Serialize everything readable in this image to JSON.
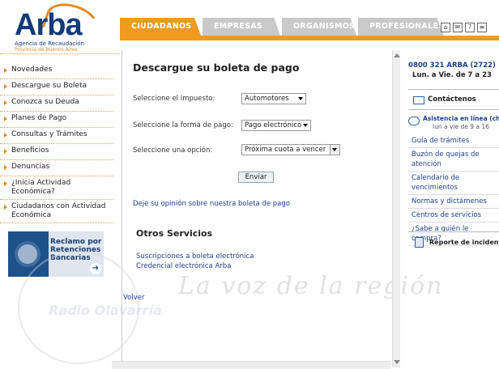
{
  "header": {
    "logo_name": "Arba",
    "logo_subtitle": "Agencia de Recaudación",
    "logo_province": "Provincia de Buenos Aires",
    "tabs": [
      {
        "label": "CIUDADANOS",
        "active": true
      },
      {
        "label": "EMPRESAS",
        "active": false
      },
      {
        "label": "ORGANISMOS",
        "active": false
      },
      {
        "label": "PROFESIONALES",
        "active": false
      }
    ],
    "tool_icons": [
      "home-icon",
      "contact-icon",
      "help-icon",
      "sitemap-icon"
    ],
    "accent_color": "#f19a1f"
  },
  "leftnav": {
    "items": [
      {
        "label": "Novedades"
      },
      {
        "label": "Descargue su Boleta"
      },
      {
        "label": "Conozca su Deuda"
      },
      {
        "label": "Planes de Pago"
      },
      {
        "label": "Consultas y Trámites"
      },
      {
        "label": "Beneficios"
      },
      {
        "label": "Denuncias"
      },
      {
        "label": "¿Inicia Actividad Económica?"
      },
      {
        "label": "Ciudadanos con Actividad Económica"
      }
    ],
    "promo": {
      "text": "Reclamo por Retenciones Bancarias"
    }
  },
  "main": {
    "title": "Descargue su boleta de pago",
    "fields": [
      {
        "label": "Seleccione el Impuesto:",
        "value": "Automotores"
      },
      {
        "label": "Seleccione la forma de pago:",
        "value": "Pago electrónico"
      },
      {
        "label": "Seleccione una opción:",
        "value": "Próxima cuota a vencer"
      }
    ],
    "submit_label": "Enviar",
    "opinion_link": "Deje su opinión sobre nuestra boleta de pago",
    "otros_title": "Otros Servicios",
    "otros_links": [
      "Suscripciones a boleta electrónica",
      "Credencial electrónica Arba"
    ],
    "back_link": "Volver"
  },
  "rightcol": {
    "phone": "0800 321 ARBA (2722)",
    "hours": "Lun. a Vie. de 7 a 23",
    "contact": "Contáctenos",
    "chat_title": "Asistencia en línea (chat)",
    "chat_hours": "lun a vie de 9 a 16",
    "links": [
      "Guía de trámites",
      "Buzón de quejas de atención",
      "Calendario de vencimientos",
      "Normas y dictámenes",
      "Centros de servicios",
      "¿Sabe a quién le compra?"
    ],
    "report": "Reporte de incidentes"
  },
  "watermark": {
    "text": "La voz de la región",
    "seal": "Radio Olavarría"
  }
}
